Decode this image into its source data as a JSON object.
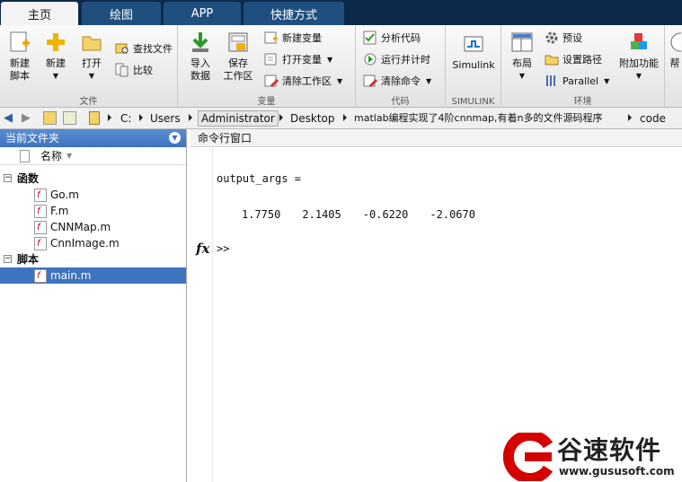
{
  "tabs": [
    "主页",
    "绘图",
    "APP",
    "快捷方式"
  ],
  "ribbon": {
    "file": {
      "new_script": [
        "新建",
        "脚本"
      ],
      "new": "新建",
      "open": "打开",
      "find_files": "查找文件",
      "compare": "比较",
      "group": "文件"
    },
    "variable": {
      "import": [
        "导入",
        "数据"
      ],
      "save": [
        "保存",
        "工作区"
      ],
      "new_var": "新建变量",
      "open_var": "打开变量",
      "clear_ws": "清除工作区",
      "group": "变量"
    },
    "code": {
      "analyze": "分析代码",
      "run_time": "运行并计时",
      "clear_cmd": "清除命令",
      "group": "代码"
    },
    "simulink": {
      "btn": "Simulink",
      "group": "SIMULINK"
    },
    "env": {
      "layout": "布局",
      "prefs": "预设",
      "set_path": "设置路径",
      "parallel": "Parallel",
      "addons": "附加功能",
      "group": "环境"
    },
    "help_cut": "帮"
  },
  "address": {
    "crumbs": [
      "C:",
      "Users",
      "Administrator",
      "Desktop",
      "matlab编程实现了4阶cnnmap,有着n多的文件源码程序",
      "code"
    ]
  },
  "current_folder": {
    "title": "当前文件夹",
    "column": "名称",
    "sections": [
      {
        "label": "函数",
        "files": [
          "Go.m",
          "F.m",
          "CNNMap.m",
          "CnnImage.m"
        ]
      },
      {
        "label": "脚本",
        "files": [
          "main.m"
        ]
      }
    ],
    "selected": "main.m"
  },
  "command_window": {
    "title": "命令行窗口",
    "var_line": "output_args =",
    "values": [
      "1.7750",
      "2.1405",
      "-0.6220",
      "-2.0670"
    ],
    "prompt": ">>",
    "fx": "fx"
  },
  "watermark": {
    "name": "谷速软件",
    "url": "www.gususoft.com",
    "color": "#d40000"
  }
}
